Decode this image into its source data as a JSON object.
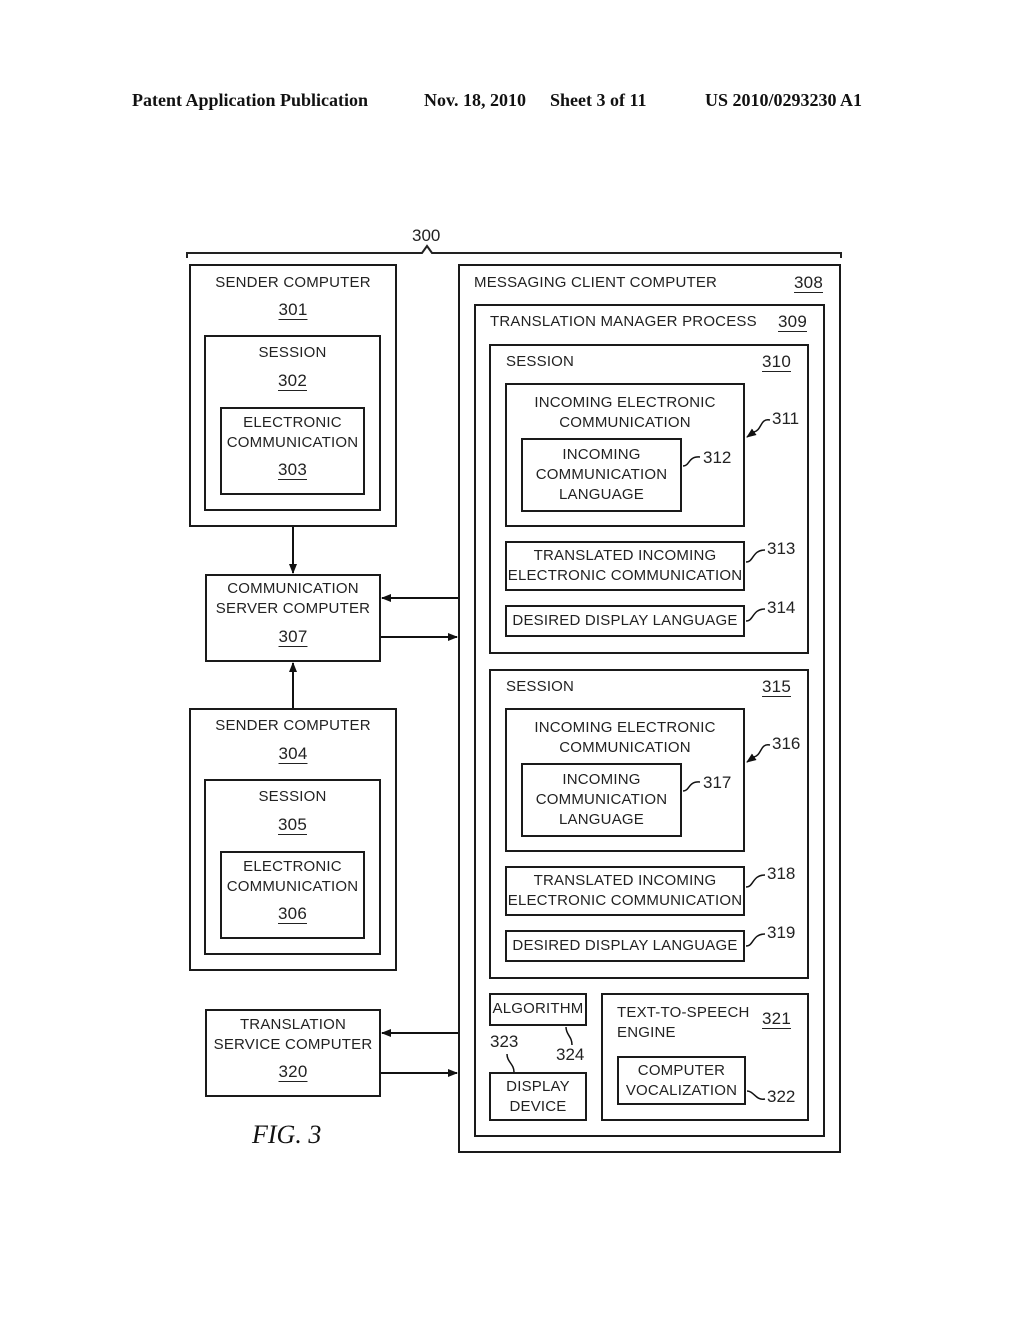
{
  "header": {
    "publication": "Patent Application Publication",
    "date": "Nov. 18, 2010",
    "sheet": "Sheet 3 of 11",
    "number": "US 2010/0293230 A1"
  },
  "system": {
    "ref": "300"
  },
  "sender1": {
    "title": "SENDER COMPUTER",
    "ref": "301",
    "session": {
      "title": "SESSION",
      "ref": "302"
    },
    "comm": {
      "line1": "ELECTRONIC",
      "line2": "COMMUNICATION",
      "ref": "303"
    }
  },
  "server": {
    "line1": "COMMUNICATION",
    "line2": "SERVER COMPUTER",
    "ref": "307"
  },
  "sender2": {
    "title": "SENDER COMPUTER",
    "ref": "304",
    "session": {
      "title": "SESSION",
      "ref": "305"
    },
    "comm": {
      "line1": "ELECTRONIC",
      "line2": "COMMUNICATION",
      "ref": "306"
    }
  },
  "translation_service": {
    "line1": "TRANSLATION",
    "line2": "SERVICE COMPUTER",
    "ref": "320"
  },
  "client": {
    "title": "MESSAGING CLIENT COMPUTER",
    "ref": "308",
    "manager": {
      "title": "TRANSLATION MANAGER PROCESS",
      "ref": "309",
      "sessions": [
        {
          "title": "SESSION",
          "ref": "310",
          "incoming": {
            "line1": "INCOMING ELECTRONIC",
            "line2": "COMMUNICATION",
            "ref": "311"
          },
          "language": {
            "line1": "INCOMING",
            "line2": "COMMUNICATION",
            "line3": "LANGUAGE",
            "ref": "312"
          },
          "translated": {
            "line1": "TRANSLATED INCOMING",
            "line2": "ELECTRONIC COMMUNICATION",
            "ref": "313"
          },
          "desired": {
            "label": "DESIRED DISPLAY LANGUAGE",
            "ref": "314"
          }
        },
        {
          "title": "SESSION",
          "ref": "315",
          "incoming": {
            "line1": "INCOMING ELECTRONIC",
            "line2": "COMMUNICATION",
            "ref": "316"
          },
          "language": {
            "line1": "INCOMING",
            "line2": "COMMUNICATION",
            "line3": "LANGUAGE",
            "ref": "317"
          },
          "translated": {
            "line1": "TRANSLATED INCOMING",
            "line2": "ELECTRONIC COMMUNICATION",
            "ref": "318"
          },
          "desired": {
            "label": "DESIRED DISPLAY LANGUAGE",
            "ref": "319"
          }
        }
      ],
      "algorithm": {
        "label": "ALGORITHM",
        "ref": "324"
      },
      "display": {
        "line1": "DISPLAY",
        "line2": "DEVICE",
        "ref": "323"
      },
      "tts": {
        "line1": "TEXT-TO-SPEECH",
        "line2": "ENGINE",
        "ref": "321",
        "vocal": {
          "line1": "COMPUTER",
          "line2": "VOCALIZATION",
          "ref": "322"
        }
      }
    }
  },
  "figure_label": "FIG. 3"
}
